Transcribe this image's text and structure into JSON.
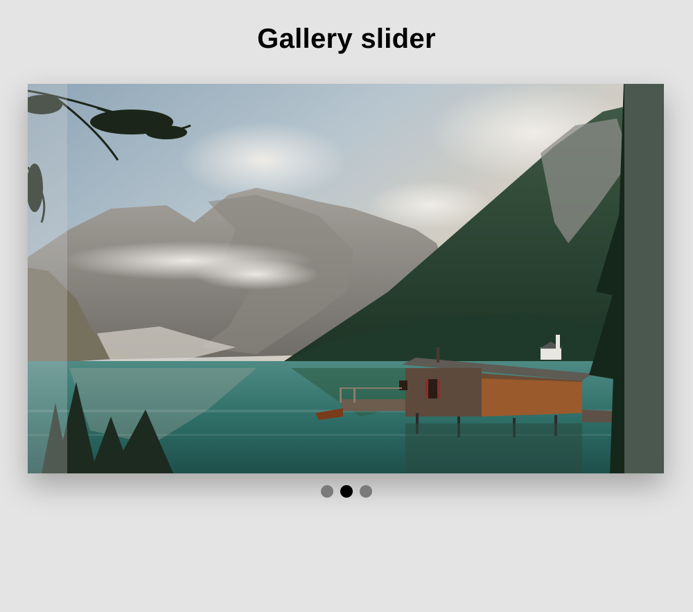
{
  "page": {
    "title": "Gallery slider"
  },
  "slider": {
    "current_slide": 2,
    "total_slides": 3,
    "image_icon": "lake-house-mountain-photo",
    "dots": [
      {
        "active": false
      },
      {
        "active": true
      },
      {
        "active": false
      }
    ]
  },
  "colors": {
    "background": "#e4e4e4",
    "dot_inactive": "#7a7a7a",
    "dot_active": "#000000"
  }
}
